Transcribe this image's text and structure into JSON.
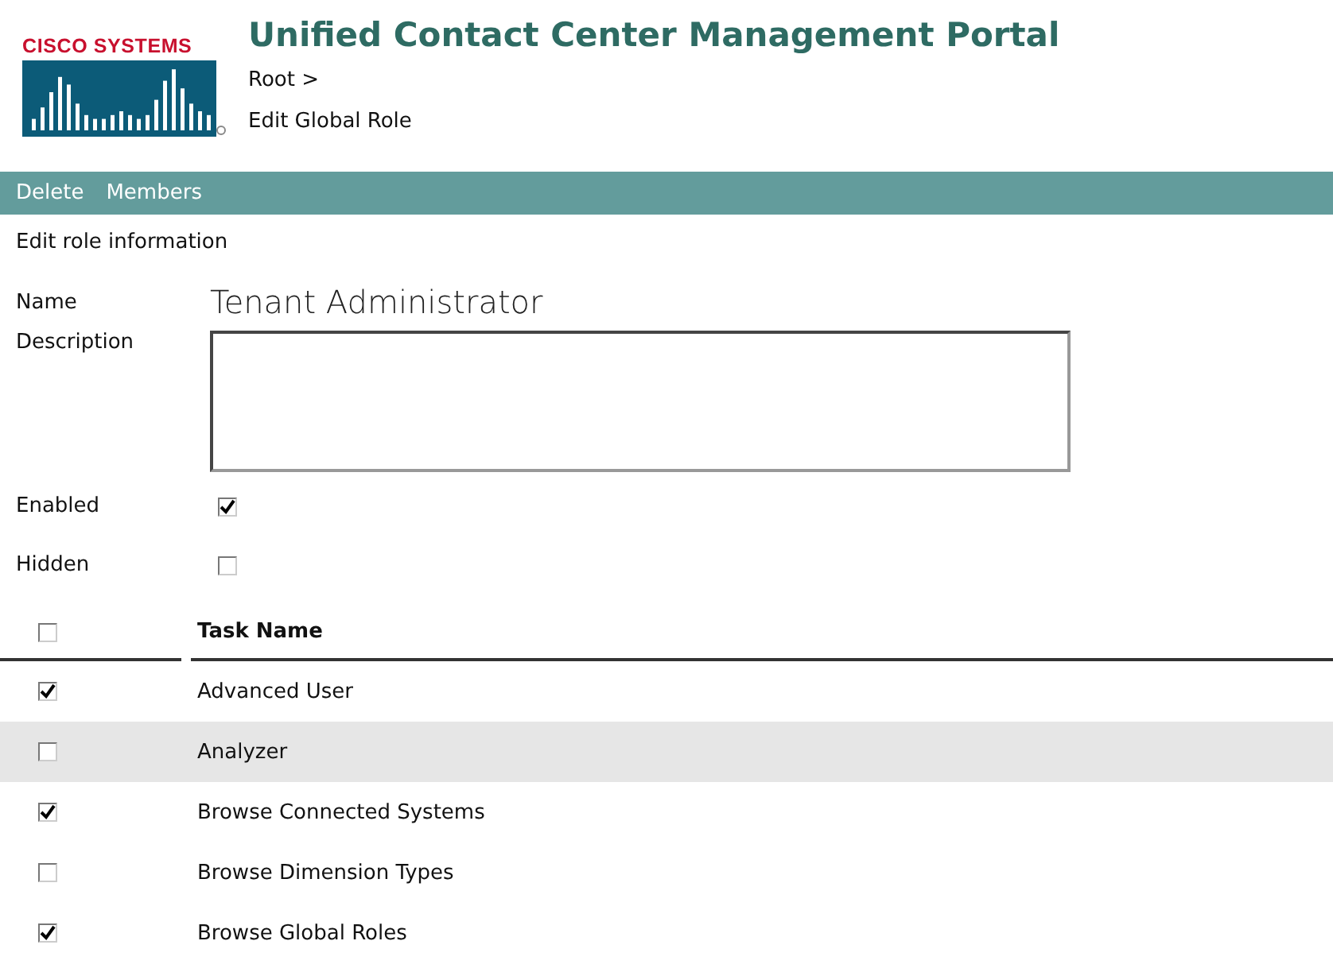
{
  "logo": {
    "text": "CISCO SYSTEMS"
  },
  "header": {
    "title": "Unified Contact Center Management Portal",
    "breadcrumb": [
      "Root >",
      "Edit Global Role"
    ]
  },
  "toolbar": [
    "Delete",
    "Members"
  ],
  "section_title": "Edit role information",
  "form": {
    "name_label": "Name",
    "name_value": "Tenant Administrator",
    "description_label": "Description",
    "enabled_label": "Enabled",
    "enabled": true,
    "hidden_label": "Hidden",
    "hidden": false
  },
  "table": {
    "select_all": false,
    "column": "Task Name",
    "rows": [
      {
        "name": "Advanced User",
        "checked": true,
        "highlighted": false
      },
      {
        "name": "Analyzer",
        "checked": false,
        "highlighted": true
      },
      {
        "name": "Browse Connected Systems",
        "checked": true,
        "highlighted": false
      },
      {
        "name": "Browse Dimension Types",
        "checked": false,
        "highlighted": false
      },
      {
        "name": "Browse Global Roles",
        "checked": true,
        "highlighted": false
      }
    ]
  }
}
